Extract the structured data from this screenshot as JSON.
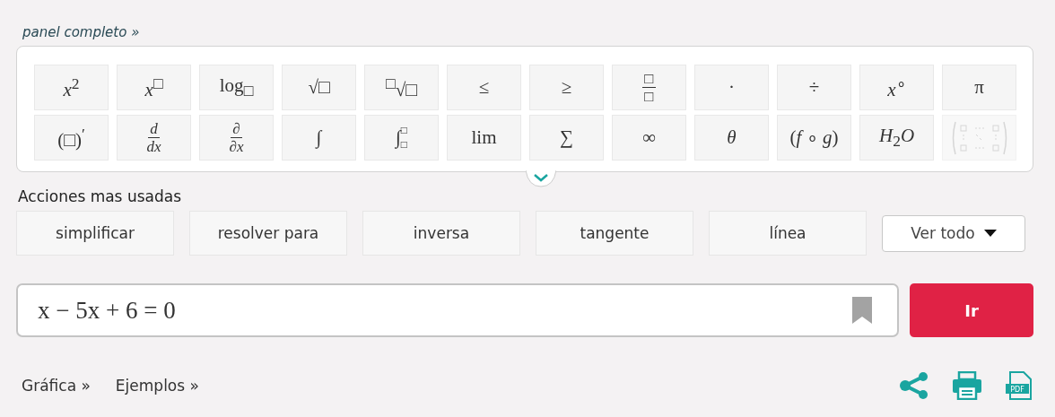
{
  "panel_link": "panel completo »",
  "keys": [
    {
      "kind": "text",
      "label": "*x*$^{2}$",
      "disabled": false
    },
    {
      "kind": "text",
      "label": "*x*$^{□}$",
      "disabled": false
    },
    {
      "kind": "text",
      "label": "log$_{□}$",
      "disabled": false
    },
    {
      "kind": "text",
      "label": "√□",
      "disabled": false
    },
    {
      "kind": "text",
      "label": "$^{□}$√□",
      "disabled": false
    },
    {
      "kind": "text",
      "label": "≤",
      "disabled": false
    },
    {
      "kind": "text",
      "label": "≥",
      "disabled": false
    },
    {
      "kind": "fraction",
      "num": "□",
      "den": "□",
      "disabled": false
    },
    {
      "kind": "text",
      "label": "·",
      "disabled": false
    },
    {
      "kind": "text",
      "label": "÷",
      "disabled": false
    },
    {
      "kind": "text",
      "label": "*x*$^{∘}$",
      "disabled": false
    },
    {
      "kind": "text",
      "label": "π",
      "disabled": false
    },
    {
      "kind": "text",
      "label": "(□)$^{′}$",
      "disabled": false
    },
    {
      "kind": "fraction",
      "num": "*d*",
      "den": "*dx*",
      "disabled": false
    },
    {
      "kind": "fraction",
      "num": "∂",
      "den": "∂*x*",
      "disabled": false
    },
    {
      "kind": "text",
      "label": "∫",
      "disabled": false
    },
    {
      "kind": "limits",
      "sym": "∫",
      "sup": "□",
      "sub": "□",
      "disabled": false
    },
    {
      "kind": "text",
      "label": "lim",
      "disabled": false
    },
    {
      "kind": "text",
      "label": "∑",
      "disabled": false
    },
    {
      "kind": "text",
      "label": "∞",
      "disabled": false
    },
    {
      "kind": "text",
      "label": "*θ*",
      "disabled": false
    },
    {
      "kind": "text",
      "label": "(*f* ∘ *g*)",
      "disabled": false
    },
    {
      "kind": "text",
      "label": "*H*$_{2}$*O*",
      "disabled": false
    },
    {
      "kind": "matrix",
      "disabled": true
    }
  ],
  "actions_title": "Acciones mas usadas",
  "actions": [
    "simplificar",
    "resolver para",
    "inversa",
    "tangente",
    "línea"
  ],
  "see_all": "Ver todo",
  "expression": "x − 5x + 6 = 0",
  "go_button": "Ir",
  "footer_links": [
    "Gráfica »",
    "Ejemplos »"
  ],
  "pdf_label": "PDF"
}
